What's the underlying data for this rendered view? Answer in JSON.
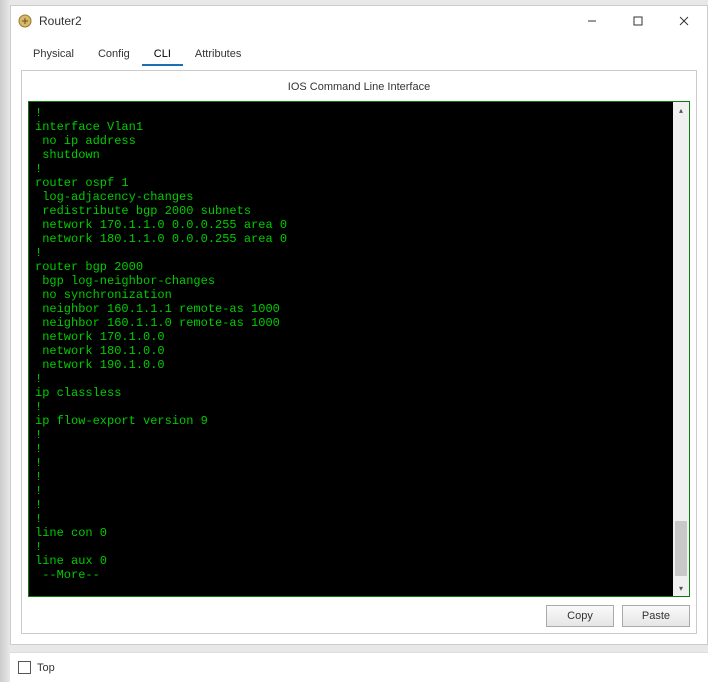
{
  "window": {
    "title": "Router2"
  },
  "tabs": {
    "physical": "Physical",
    "config": "Config",
    "cli": "CLI",
    "attributes": "Attributes",
    "active": "cli"
  },
  "cli": {
    "heading": "IOS Command Line Interface",
    "lines": [
      "!",
      "interface Vlan1",
      " no ip address",
      " shutdown",
      "!",
      "router ospf 1",
      " log-adjacency-changes",
      " redistribute bgp 2000 subnets",
      " network 170.1.1.0 0.0.0.255 area 0",
      " network 180.1.1.0 0.0.0.255 area 0",
      "!",
      "router bgp 2000",
      " bgp log-neighbor-changes",
      " no synchronization",
      " neighbor 160.1.1.1 remote-as 1000",
      " neighbor 160.1.1.0 remote-as 1000",
      " network 170.1.0.0",
      " network 180.1.0.0",
      " network 190.1.0.0",
      "!",
      "ip classless",
      "!",
      "ip flow-export version 9",
      "!",
      "!",
      "!",
      "!",
      "!",
      "!",
      "!",
      "line con 0",
      "!",
      "line aux 0",
      " --More--"
    ]
  },
  "buttons": {
    "copy": "Copy",
    "paste": "Paste"
  },
  "bottom": {
    "top_label": "Top",
    "top_checked": false
  }
}
